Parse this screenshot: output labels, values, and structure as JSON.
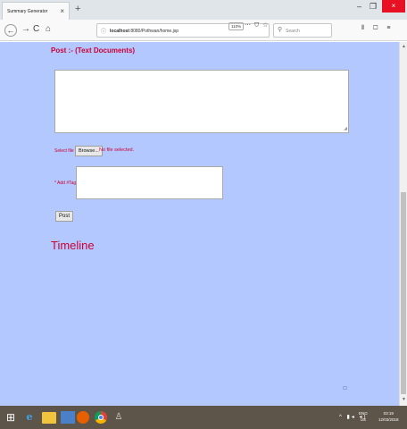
{
  "browser": {
    "tab_title": "Summary Generator",
    "tab_close": "×",
    "new_tab": "+",
    "window_controls": {
      "minimize": "–",
      "maximize": "❐",
      "close": "×"
    },
    "nav": {
      "back": "←",
      "forward": "→",
      "reload": "C",
      "home": "⌂"
    },
    "url_host": "localhost",
    "url_path": ":8080/Pothwan/home.jsp",
    "zoom": "110%",
    "page_actions": "⋯ ⛉ ☆",
    "search_placeholder": "Search",
    "toolbar_icons": "⫴ ▢ ≡"
  },
  "page": {
    "post_heading": "Post :- (Text Documents)",
    "select_file_label": "Select file :",
    "browse_button": "Browse...",
    "no_file_text": "No file selected.",
    "add_tag_label": "* Add #Tag :",
    "post_button": "Post",
    "timeline_heading": "Timeline"
  },
  "taskbar": {
    "start_icon": "⊞",
    "ie_icon": "e",
    "tray_icons": "^ ▮◂ ◂)",
    "lang_top": "ENG",
    "lang_bottom": "US",
    "time": "03:19",
    "date": "12/03/2018"
  },
  "colors": {
    "page_background": "#b3c8ff",
    "accent_red": "#cc0033",
    "taskbar": "#5d5549"
  }
}
